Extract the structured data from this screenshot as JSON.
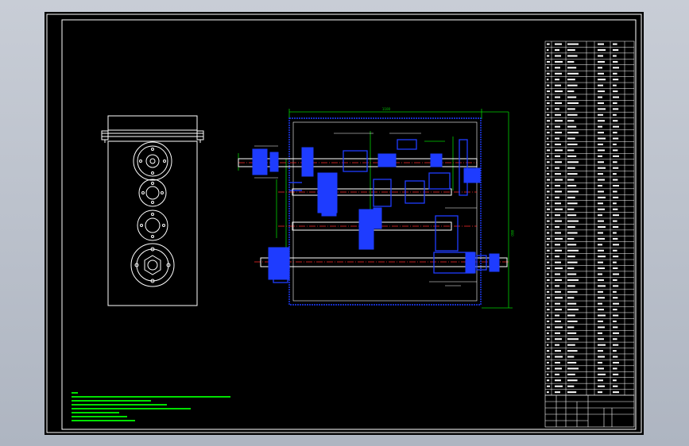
{
  "app": {
    "viewport": "cad-model-space"
  },
  "colors": {
    "background": "#000000",
    "frame": "#ffffff",
    "housing": "#1e3cff",
    "shaft": "#ffffff",
    "centerline": "#ff2a2a",
    "dimension": "#00d000",
    "gear": "#1e3cff",
    "notes": "#00e000"
  },
  "dimensions": {
    "top_width": "1100",
    "right_height": "860"
  }
}
